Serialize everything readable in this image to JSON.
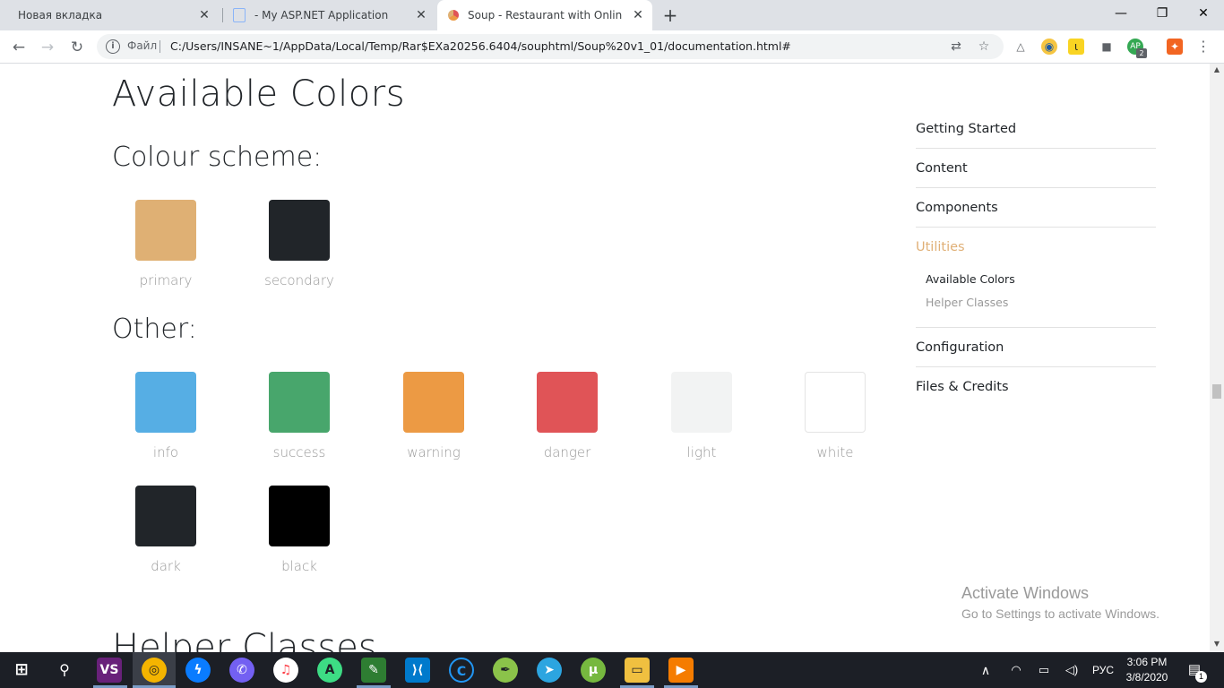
{
  "browser": {
    "tabs": [
      {
        "title": "Новая вкладка"
      },
      {
        "title": "- My ASP.NET Application"
      },
      {
        "title": "Soup - Restaurant with Online Or"
      }
    ],
    "new_tab": "+",
    "window_controls": {
      "minimize": "—",
      "maximize": "❐",
      "close": "✕"
    },
    "omnibox": {
      "scheme_label": "Файл",
      "url": "C:/Users/INSANE~1/AppData/Local/Temp/Rar$EXa20256.6404/souphtml/Soup%20v1_01/documentation.html#"
    },
    "profile_badge": "2"
  },
  "page": {
    "title": "Available Colors",
    "scheme_heading": "Colour scheme:",
    "other_heading": "Other:",
    "next_heading": "Helper Classes",
    "scheme_colors": [
      {
        "label": "primary",
        "color": "#dfb074"
      },
      {
        "label": "secondary",
        "color": "#212529"
      }
    ],
    "other_colors": [
      {
        "label": "info",
        "color": "#56aee4"
      },
      {
        "label": "success",
        "color": "#48a66c"
      },
      {
        "label": "warning",
        "color": "#ec9a44"
      },
      {
        "label": "danger",
        "color": "#e05457"
      },
      {
        "label": "light",
        "color": "#f2f3f3"
      },
      {
        "label": "white",
        "color": "#ffffff"
      },
      {
        "label": "dark",
        "color": "#212529"
      },
      {
        "label": "black",
        "color": "#000000"
      }
    ]
  },
  "sidenav": {
    "items": [
      {
        "label": "Getting Started"
      },
      {
        "label": "Content"
      },
      {
        "label": "Components"
      },
      {
        "label": "Utilities"
      },
      {
        "label": "Configuration"
      },
      {
        "label": "Files & Credits"
      }
    ],
    "sub_items": [
      {
        "label": "Available Colors"
      },
      {
        "label": "Helper Classes"
      }
    ],
    "accent_color": "#e0b077"
  },
  "watermark": {
    "line1": "Activate Windows",
    "line2": "Go to Settings to activate Windows."
  },
  "taskbar": {
    "language": "РУС",
    "time": "3:06 PM",
    "date": "3/8/2020",
    "notification_count": "1"
  }
}
